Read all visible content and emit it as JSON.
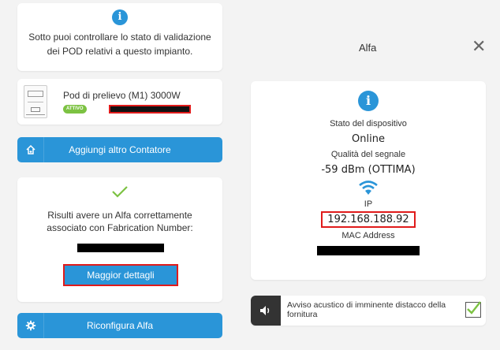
{
  "left": {
    "info_text": "Sotto puoi controllare lo stato di validazione dei POD relativi a questo impianto.",
    "pod": {
      "title": "Pod di prelievo (M1) 3000W",
      "badge": "ATTIVO"
    },
    "add_meter_label": "Aggiungi altro Contatore",
    "success_text": "Risulti avere un Alfa correttamente associato con Fabrication Number:",
    "details_button": "Maggior dettagli",
    "reconfigure_label": "Riconfigura Alfa"
  },
  "right": {
    "title": "Alfa",
    "device_state_label": "Stato del dispositivo",
    "device_state_value": "Online",
    "signal_label": "Qualità del segnale",
    "signal_value": "-59 dBm (OTTIMA)",
    "ip_label": "IP",
    "ip_value": "192.168.188.92",
    "mac_label": "MAC Address",
    "alert_text": "Avviso acustico di imminente distacco della fornitura",
    "alert_checked": true
  },
  "colors": {
    "accent": "#2a95d8",
    "success": "#7cc242",
    "highlight": "#e01b1b"
  }
}
